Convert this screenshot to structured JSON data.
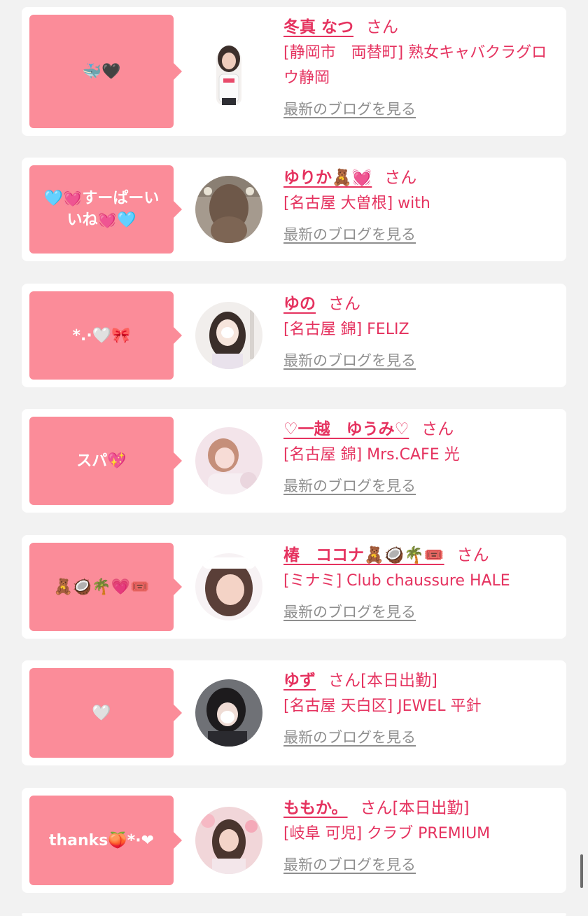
{
  "blog_link_label": "最新のブログを見る",
  "colors": {
    "accent": "#e5325f",
    "bubble": "#fb8c99",
    "background": "#f2f2f2",
    "card": "#ffffff",
    "link_gray": "#8e8e8e"
  },
  "entries": [
    {
      "comment": "🐳🖤",
      "name": "冬真 なつ",
      "suffix": "さん",
      "shop": "[静岡市　両替町] 熟女キャバクラグロウ静岡",
      "avatar": "photo"
    },
    {
      "comment": "🩵💓すーぱーいいね💓🩵",
      "name": "ゆりか🧸💓",
      "suffix": "さん",
      "shop": "[名古屋 大曽根] with",
      "avatar": "photo"
    },
    {
      "comment": "*.·🤍🎀",
      "name": "ゆの",
      "suffix": "さん",
      "shop": "[名古屋 錦] FELIZ",
      "avatar": "photo"
    },
    {
      "comment": "スパ💖",
      "name": "♡一越　ゆうみ♡",
      "suffix": "さん",
      "shop": "[名古屋 錦] Mrs.CAFE 光",
      "avatar": "photo"
    },
    {
      "comment": "🧸🥥🌴💗🎟️",
      "name": "椿　ココナ🧸🥥🌴🎟️",
      "suffix": "さん",
      "shop": "[ミナミ] Club chaussure HALE",
      "avatar": "photo"
    },
    {
      "comment": "🤍",
      "name": "ゆず",
      "suffix": "さん[本日出勤]",
      "shop": "[名古屋 天白区] JEWEL 平針",
      "avatar": "photo"
    },
    {
      "comment": "thanks🍑*·❤",
      "name": "ももか。",
      "suffix": "さん[本日出勤]",
      "shop": "[岐阜 可児] クラブ PREMIUM",
      "avatar": "photo"
    }
  ]
}
